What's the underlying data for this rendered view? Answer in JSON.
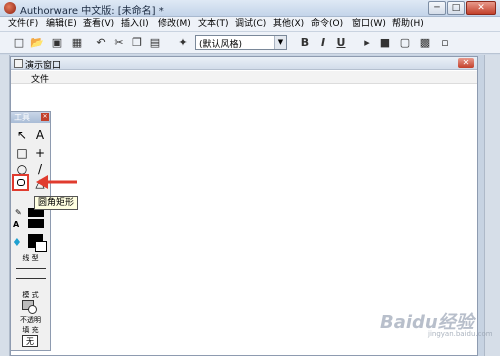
{
  "window": {
    "title": "Authorware 中文版: [未命名] *",
    "min": "─",
    "max": "□",
    "close": "✕"
  },
  "menu": [
    "文件(F)",
    "编辑(E)",
    "查看(V)",
    "插入(I)",
    "修改(M)",
    "文本(T)",
    "调试(C)",
    "其他(X)",
    "命令(O)",
    "窗口(W)",
    "帮助(H)"
  ],
  "toolbar": {
    "style_value": "(默认风格)",
    "bold": "B",
    "italic": "I",
    "underline": "U"
  },
  "presentation_window": {
    "title": "演示窗口",
    "menu_file": "文件",
    "close": "✕"
  },
  "palette": {
    "title": "工具",
    "close": "✕",
    "tools": [
      "↖",
      "A",
      "□",
      "+",
      "○",
      "/"
    ],
    "section_line": "线 型",
    "section_mode": "模 式",
    "mode_value": "不透明",
    "section_fill": "填 充",
    "fill_value": "无"
  },
  "tooltip": "圆角矩形",
  "watermark": {
    "brand": "Baidu经验",
    "url": "jingyan.baidu.com"
  },
  "colors": {
    "highlight": "#e03b2e",
    "tooltip_bg": "#ffffe1"
  }
}
